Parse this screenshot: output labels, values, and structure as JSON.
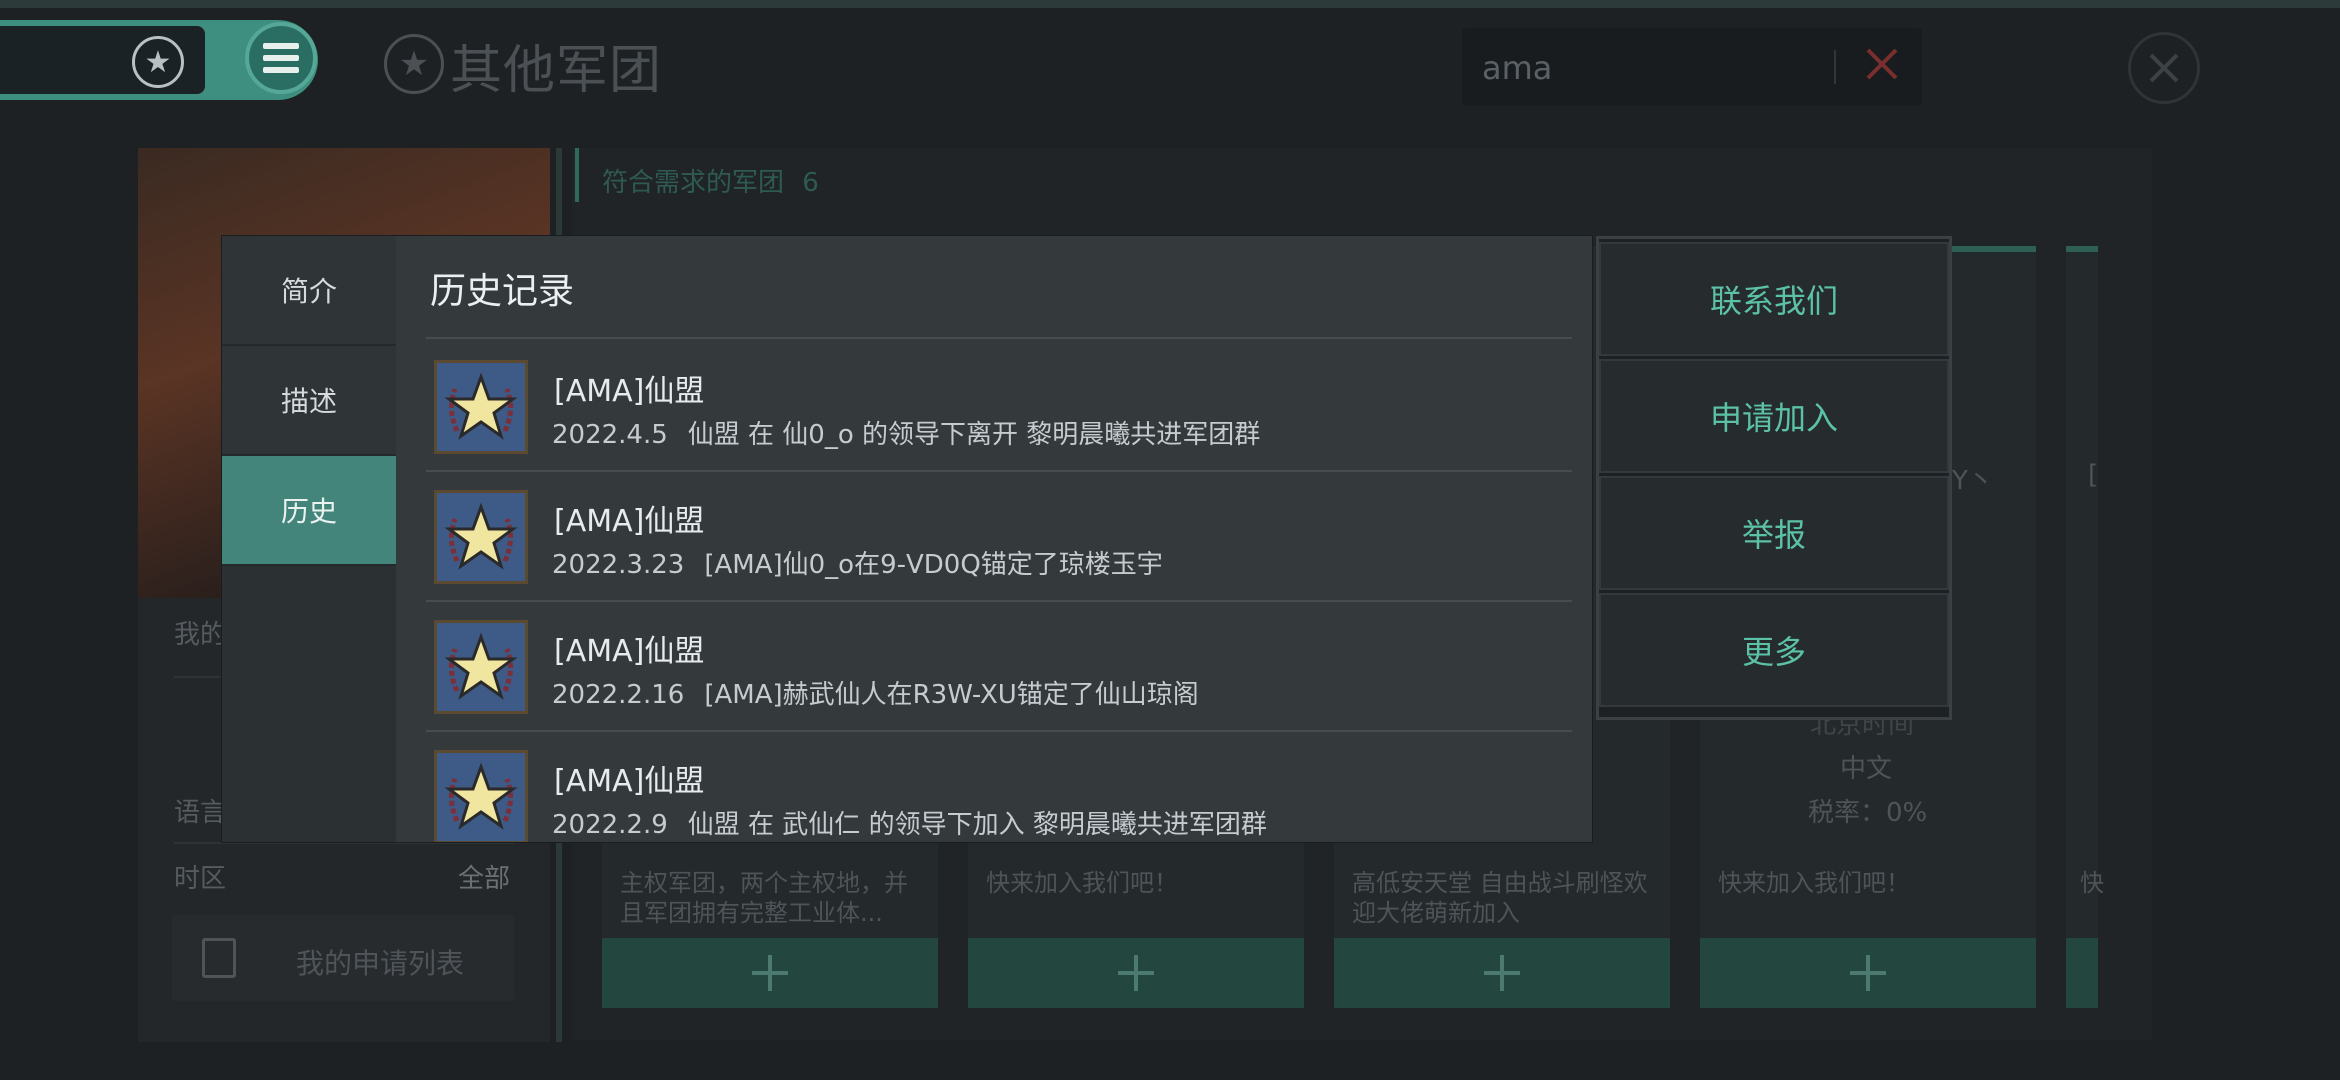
{
  "header": {
    "title": "其他军团",
    "search_value": "ama"
  },
  "left_panel": {
    "my_label": "我的",
    "language_label": "语言",
    "timezone_label": "时区",
    "timezone_value": "全部",
    "apply_list_label": "我的申请列表"
  },
  "main": {
    "match_label": "符合需求的军团",
    "match_count": "6",
    "cards": [
      {
        "desc": "主权军团，两个主权地，并且军团拥有完整工业体..."
      },
      {
        "desc": "快来加入我们吧！"
      },
      {
        "desc": "高低安天堂 自由战斗刷怪欢迎大佬萌新加入"
      },
      {
        "desc": "快来加入我们吧！",
        "timezone": "北京时间",
        "language": "中文",
        "tax": "税率：0%",
        "name_fragment": "Y丶"
      }
    ],
    "edge_card_fragment": "[",
    "edge_card_desc_fragment": "快"
  },
  "modal": {
    "tabs": [
      "简介",
      "描述",
      "历史"
    ],
    "active_tab": 2,
    "title": "历史记录",
    "entries": [
      {
        "name": "[AMA]仙盟",
        "date": "2022.4.5",
        "text": "仙盟 在 仙0_o 的领导下离开 黎明晨曦共进军团群"
      },
      {
        "name": "[AMA]仙盟",
        "date": "2022.3.23",
        "text": "[AMA]仙0_o在9-VD0Q锚定了琼楼玉宇"
      },
      {
        "name": "[AMA]仙盟",
        "date": "2022.2.16",
        "text": "[AMA]赫武仙人在R3W-XU锚定了仙山琼阁"
      },
      {
        "name": "[AMA]仙盟",
        "date": "2022.2.9",
        "text": "仙盟 在 武仙仁 的领导下加入 黎明晨曦共进军团群"
      }
    ]
  },
  "actions": [
    "联系我们",
    "申请加入",
    "举报",
    "更多"
  ],
  "colors": {
    "accent": "#43857a",
    "action_text": "#5bc2a8",
    "icon_star_fill": "#f1e6a0",
    "icon_bg": "#3e5a86"
  }
}
